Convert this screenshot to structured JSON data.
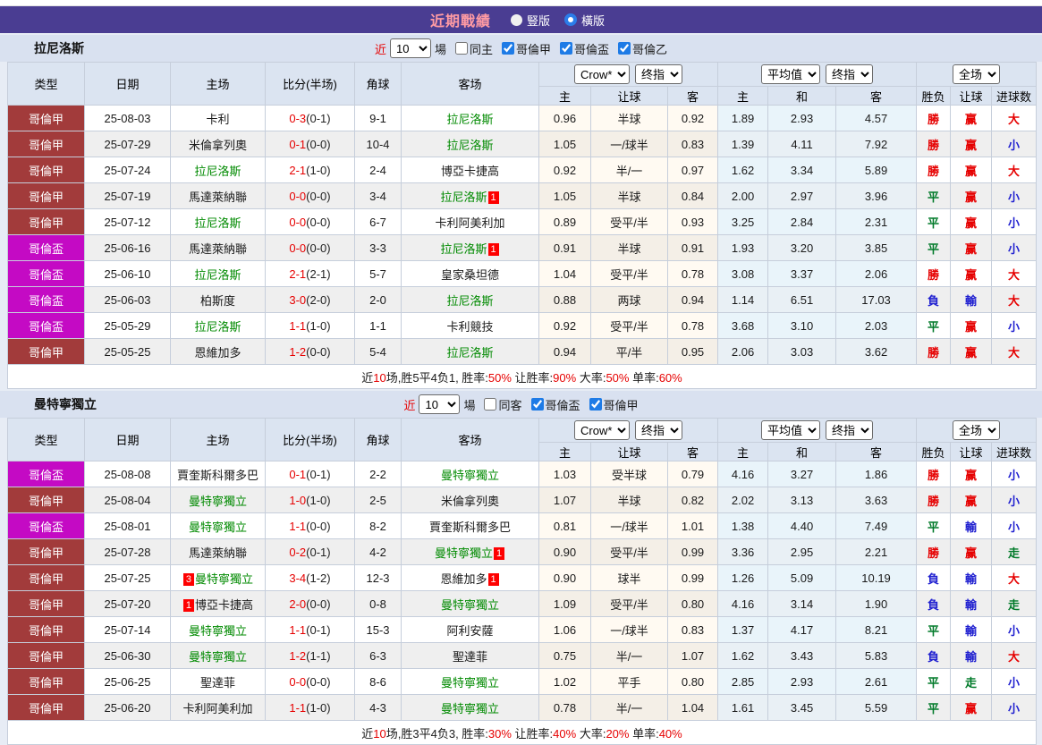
{
  "title_bar": {
    "title": "近期戰績",
    "radios": [
      {
        "label": "豎版",
        "selected": false
      },
      {
        "label": "橫版",
        "selected": true
      }
    ]
  },
  "table_template": {
    "near_label": "近",
    "games_value": "10",
    "games_suffix": "場",
    "left_headers": [
      "类型",
      "日期",
      "主场",
      "比分(半场)",
      "角球",
      "客场"
    ],
    "sub_headers": [
      "主",
      "让球",
      "客",
      "主",
      "和",
      "客",
      "胜负",
      "让球",
      "进球数"
    ],
    "dropdowns": {
      "odds_source": "Crow*",
      "final1": "终指",
      "average": "平均值",
      "final2": "终指",
      "scope": "全场"
    }
  },
  "colors": {
    "red": "#e60000",
    "liga_bg": "#a23b3b",
    "cup_bg": "#c40ac4",
    "highlight_team": "#008a00",
    "result_text": {
      "勝": "#e60000",
      "赢": "#e60000",
      "大": "#e60000",
      "平": "#007a29",
      "走": "#007a29",
      "負": "#2020d0",
      "輸": "#2020d0",
      "小": "#2020d0"
    }
  },
  "sections": [
    {
      "team": "拉尼洛斯",
      "same_filter": {
        "label": "同主",
        "checked": false
      },
      "league_filters": [
        {
          "label": "哥倫甲",
          "checked": true
        },
        {
          "label": "哥倫盃",
          "checked": true
        },
        {
          "label": "哥倫乙",
          "checked": true
        }
      ],
      "rows": [
        {
          "league": "哥倫甲",
          "league_type": "liga",
          "date": "25-08-03",
          "home": {
            "name": "卡利"
          },
          "score": "0-3",
          "half": "(0-1)",
          "corner": "9-1",
          "away": {
            "name": "拉尼洛斯",
            "highlight": true
          },
          "odds": [
            "0.96",
            "半球",
            "0.92"
          ],
          "avg": [
            "1.89",
            "2.93",
            "4.57"
          ],
          "results": [
            "勝",
            "赢",
            "大"
          ]
        },
        {
          "league": "哥倫甲",
          "league_type": "liga",
          "date": "25-07-29",
          "home": {
            "name": "米倫拿列奧"
          },
          "score": "0-1",
          "half": "(0-0)",
          "corner": "10-4",
          "away": {
            "name": "拉尼洛斯",
            "highlight": true
          },
          "odds": [
            "1.05",
            "一/球半",
            "0.83"
          ],
          "avg": [
            "1.39",
            "4.11",
            "7.92"
          ],
          "results": [
            "勝",
            "赢",
            "小"
          ]
        },
        {
          "league": "哥倫甲",
          "league_type": "liga",
          "date": "25-07-24",
          "home": {
            "name": "拉尼洛斯",
            "highlight": true
          },
          "score": "2-1",
          "half": "(1-0)",
          "corner": "2-4",
          "away": {
            "name": "博亞卡捷高"
          },
          "odds": [
            "0.92",
            "半/一",
            "0.97"
          ],
          "avg": [
            "1.62",
            "3.34",
            "5.89"
          ],
          "results": [
            "勝",
            "赢",
            "大"
          ]
        },
        {
          "league": "哥倫甲",
          "league_type": "liga",
          "date": "25-07-19",
          "home": {
            "name": "馬達萊納聯"
          },
          "score": "0-0",
          "half": "(0-0)",
          "corner": "3-4",
          "away": {
            "name": "拉尼洛斯",
            "highlight": true,
            "badge_after": "1"
          },
          "odds": [
            "1.05",
            "半球",
            "0.84"
          ],
          "avg": [
            "2.00",
            "2.97",
            "3.96"
          ],
          "results": [
            "平",
            "赢",
            "小"
          ]
        },
        {
          "league": "哥倫甲",
          "league_type": "liga",
          "date": "25-07-12",
          "home": {
            "name": "拉尼洛斯",
            "highlight": true
          },
          "score": "0-0",
          "half": "(0-0)",
          "corner": "6-7",
          "away": {
            "name": "卡利阿美利加"
          },
          "odds": [
            "0.89",
            "受平/半",
            "0.93"
          ],
          "avg": [
            "3.25",
            "2.84",
            "2.31"
          ],
          "results": [
            "平",
            "赢",
            "小"
          ]
        },
        {
          "league": "哥倫盃",
          "league_type": "cup",
          "date": "25-06-16",
          "home": {
            "name": "馬達萊納聯"
          },
          "score": "0-0",
          "half": "(0-0)",
          "corner": "3-3",
          "away": {
            "name": "拉尼洛斯",
            "highlight": true,
            "badge_after": "1"
          },
          "odds": [
            "0.91",
            "半球",
            "0.91"
          ],
          "avg": [
            "1.93",
            "3.20",
            "3.85"
          ],
          "results": [
            "平",
            "赢",
            "小"
          ]
        },
        {
          "league": "哥倫盃",
          "league_type": "cup",
          "date": "25-06-10",
          "home": {
            "name": "拉尼洛斯",
            "highlight": true
          },
          "score": "2-1",
          "half": "(2-1)",
          "corner": "5-7",
          "away": {
            "name": "皇家桑坦德"
          },
          "odds": [
            "1.04",
            "受平/半",
            "0.78"
          ],
          "avg": [
            "3.08",
            "3.37",
            "2.06"
          ],
          "results": [
            "勝",
            "赢",
            "大"
          ]
        },
        {
          "league": "哥倫盃",
          "league_type": "cup",
          "date": "25-06-03",
          "home": {
            "name": "柏斯度"
          },
          "score": "3-0",
          "half": "(2-0)",
          "corner": "2-0",
          "away": {
            "name": "拉尼洛斯",
            "highlight": true
          },
          "odds": [
            "0.88",
            "两球",
            "0.94"
          ],
          "avg": [
            "1.14",
            "6.51",
            "17.03"
          ],
          "results": [
            "負",
            "輸",
            "大"
          ]
        },
        {
          "league": "哥倫盃",
          "league_type": "cup",
          "date": "25-05-29",
          "home": {
            "name": "拉尼洛斯",
            "highlight": true
          },
          "score": "1-1",
          "half": "(1-0)",
          "corner": "1-1",
          "away": {
            "name": "卡利競技"
          },
          "odds": [
            "0.92",
            "受平/半",
            "0.78"
          ],
          "avg": [
            "3.68",
            "3.10",
            "2.03"
          ],
          "results": [
            "平",
            "赢",
            "小"
          ]
        },
        {
          "league": "哥倫甲",
          "league_type": "liga",
          "date": "25-05-25",
          "home": {
            "name": "恩維加多"
          },
          "score": "1-2",
          "half": "(0-0)",
          "corner": "5-4",
          "away": {
            "name": "拉尼洛斯",
            "highlight": true
          },
          "odds": [
            "0.94",
            "平/半",
            "0.95"
          ],
          "avg": [
            "2.06",
            "3.03",
            "3.62"
          ],
          "results": [
            "勝",
            "赢",
            "大"
          ]
        }
      ],
      "summary": [
        {
          "t": "近"
        },
        {
          "t": "10",
          "red": true
        },
        {
          "t": "场,胜5平4负1, 胜率:"
        },
        {
          "t": "50%",
          "red": true
        },
        {
          "t": " 让胜率:"
        },
        {
          "t": "90%",
          "red": true
        },
        {
          "t": " 大率:"
        },
        {
          "t": "50%",
          "red": true
        },
        {
          "t": " 单率:"
        },
        {
          "t": "60%",
          "red": true
        }
      ]
    },
    {
      "team": "曼特寧獨立",
      "same_filter": {
        "label": "同客",
        "checked": false
      },
      "league_filters": [
        {
          "label": "哥倫盃",
          "checked": true
        },
        {
          "label": "哥倫甲",
          "checked": true
        }
      ],
      "rows": [
        {
          "league": "哥倫盃",
          "league_type": "cup",
          "date": "25-08-08",
          "home": {
            "name": "賈奎斯科爾多巴"
          },
          "score": "0-1",
          "half": "(0-1)",
          "corner": "2-2",
          "away": {
            "name": "曼特寧獨立",
            "highlight": true
          },
          "odds": [
            "1.03",
            "受半球",
            "0.79"
          ],
          "avg": [
            "4.16",
            "3.27",
            "1.86"
          ],
          "results": [
            "勝",
            "赢",
            "小"
          ]
        },
        {
          "league": "哥倫甲",
          "league_type": "liga",
          "date": "25-08-04",
          "home": {
            "name": "曼特寧獨立",
            "highlight": true
          },
          "score": "1-0",
          "half": "(1-0)",
          "corner": "2-5",
          "away": {
            "name": "米倫拿列奧"
          },
          "odds": [
            "1.07",
            "半球",
            "0.82"
          ],
          "avg": [
            "2.02",
            "3.13",
            "3.63"
          ],
          "results": [
            "勝",
            "赢",
            "小"
          ]
        },
        {
          "league": "哥倫盃",
          "league_type": "cup",
          "date": "25-08-01",
          "home": {
            "name": "曼特寧獨立",
            "highlight": true
          },
          "score": "1-1",
          "half": "(0-0)",
          "corner": "8-2",
          "away": {
            "name": "賈奎斯科爾多巴"
          },
          "odds": [
            "0.81",
            "一/球半",
            "1.01"
          ],
          "avg": [
            "1.38",
            "4.40",
            "7.49"
          ],
          "results": [
            "平",
            "輸",
            "小"
          ]
        },
        {
          "league": "哥倫甲",
          "league_type": "liga",
          "date": "25-07-28",
          "home": {
            "name": "馬達萊納聯"
          },
          "score": "0-2",
          "half": "(0-1)",
          "corner": "4-2",
          "away": {
            "name": "曼特寧獨立",
            "highlight": true,
            "badge_after": "1"
          },
          "odds": [
            "0.90",
            "受平/半",
            "0.99"
          ],
          "avg": [
            "3.36",
            "2.95",
            "2.21"
          ],
          "results": [
            "勝",
            "赢",
            "走"
          ]
        },
        {
          "league": "哥倫甲",
          "league_type": "liga",
          "date": "25-07-25",
          "home": {
            "name": "曼特寧獨立",
            "highlight": true,
            "badge_before": "3"
          },
          "score": "3-4",
          "half": "(1-2)",
          "corner": "12-3",
          "away": {
            "name": "恩維加多",
            "badge_after": "1"
          },
          "odds": [
            "0.90",
            "球半",
            "0.99"
          ],
          "avg": [
            "1.26",
            "5.09",
            "10.19"
          ],
          "results": [
            "負",
            "輸",
            "大"
          ]
        },
        {
          "league": "哥倫甲",
          "league_type": "liga",
          "date": "25-07-20",
          "home": {
            "name": "博亞卡捷高",
            "badge_before": "1"
          },
          "score": "2-0",
          "half": "(0-0)",
          "corner": "0-8",
          "away": {
            "name": "曼特寧獨立",
            "highlight": true
          },
          "odds": [
            "1.09",
            "受平/半",
            "0.80"
          ],
          "avg": [
            "4.16",
            "3.14",
            "1.90"
          ],
          "results": [
            "負",
            "輸",
            "走"
          ]
        },
        {
          "league": "哥倫甲",
          "league_type": "liga",
          "date": "25-07-14",
          "home": {
            "name": "曼特寧獨立",
            "highlight": true
          },
          "score": "1-1",
          "half": "(0-1)",
          "corner": "15-3",
          "away": {
            "name": "阿利安薩"
          },
          "odds": [
            "1.06",
            "一/球半",
            "0.83"
          ],
          "avg": [
            "1.37",
            "4.17",
            "8.21"
          ],
          "results": [
            "平",
            "輸",
            "小"
          ]
        },
        {
          "league": "哥倫甲",
          "league_type": "liga",
          "date": "25-06-30",
          "home": {
            "name": "曼特寧獨立",
            "highlight": true
          },
          "score": "1-2",
          "half": "(1-1)",
          "corner": "6-3",
          "away": {
            "name": "聖達菲"
          },
          "odds": [
            "0.75",
            "半/一",
            "1.07"
          ],
          "avg": [
            "1.62",
            "3.43",
            "5.83"
          ],
          "results": [
            "負",
            "輸",
            "大"
          ]
        },
        {
          "league": "哥倫甲",
          "league_type": "liga",
          "date": "25-06-25",
          "home": {
            "name": "聖達菲"
          },
          "score": "0-0",
          "half": "(0-0)",
          "corner": "8-6",
          "away": {
            "name": "曼特寧獨立",
            "highlight": true
          },
          "odds": [
            "1.02",
            "平手",
            "0.80"
          ],
          "avg": [
            "2.85",
            "2.93",
            "2.61"
          ],
          "results": [
            "平",
            "走",
            "小"
          ]
        },
        {
          "league": "哥倫甲",
          "league_type": "liga",
          "date": "25-06-20",
          "home": {
            "name": "卡利阿美利加"
          },
          "score": "1-1",
          "half": "(1-0)",
          "corner": "4-3",
          "away": {
            "name": "曼特寧獨立",
            "highlight": true
          },
          "odds": [
            "0.78",
            "半/一",
            "1.04"
          ],
          "avg": [
            "1.61",
            "3.45",
            "5.59"
          ],
          "results": [
            "平",
            "赢",
            "小"
          ]
        }
      ],
      "summary": [
        {
          "t": "近"
        },
        {
          "t": "10",
          "red": true
        },
        {
          "t": "场,胜3平4负3, 胜率:"
        },
        {
          "t": "30%",
          "red": true
        },
        {
          "t": " 让胜率:"
        },
        {
          "t": "40%",
          "red": true
        },
        {
          "t": " 大率:"
        },
        {
          "t": "20%",
          "red": true
        },
        {
          "t": " 单率:"
        },
        {
          "t": "40%",
          "red": true
        }
      ]
    }
  ]
}
